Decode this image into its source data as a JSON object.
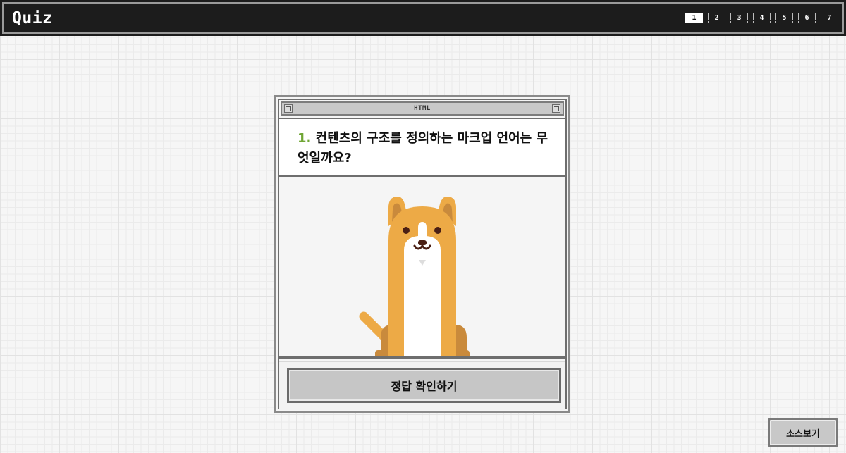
{
  "header": {
    "title": "Quiz",
    "pages": [
      "1",
      "2",
      "3",
      "4",
      "5",
      "6",
      "7"
    ],
    "active_page": "1"
  },
  "quiz_window": {
    "title": "HTML",
    "question_number": "1.",
    "question_text": "컨텐츠의 구조를 정의하는 마크업 언어는 무엇일까요?",
    "illustration": "dog-illustration",
    "check_button": "정답 확인하기"
  },
  "source_button": "소스보기",
  "colors": {
    "header_bg": "#1c1c1c",
    "question_number": "#6fa534",
    "dog_body": "#edaa46",
    "dog_dark": "#c98a3c",
    "dog_belly": "#ffffff"
  }
}
